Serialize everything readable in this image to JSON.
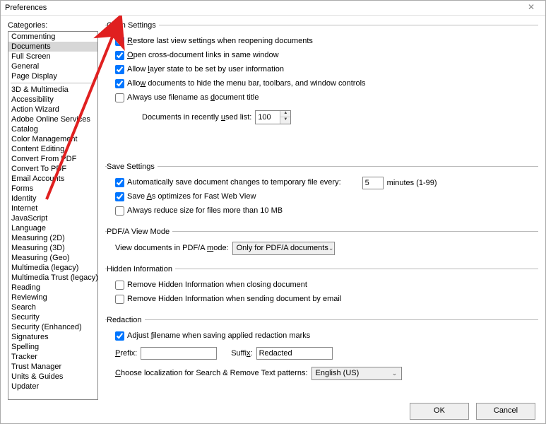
{
  "window": {
    "title": "Preferences"
  },
  "sidebar": {
    "header": "Categories:",
    "groups": [
      [
        "Commenting",
        "Documents",
        "Full Screen",
        "General",
        "Page Display"
      ],
      [
        "3D & Multimedia",
        "Accessibility",
        "Action Wizard",
        "Adobe Online Services",
        "Catalog",
        "Color Management",
        "Content Editing",
        "Convert From PDF",
        "Convert To PDF",
        "Email Accounts",
        "Forms",
        "Identity",
        "Internet",
        "JavaScript",
        "Language",
        "Measuring (2D)",
        "Measuring (3D)",
        "Measuring (Geo)",
        "Multimedia (legacy)",
        "Multimedia Trust (legacy)",
        "Reading",
        "Reviewing",
        "Search",
        "Security",
        "Security (Enhanced)",
        "Signatures",
        "Spelling",
        "Tracker",
        "Trust Manager",
        "Units & Guides",
        "Updater"
      ]
    ],
    "selected": "Documents"
  },
  "open_settings": {
    "legend": "Open Settings",
    "restore": "Restore last view settings when reopening documents",
    "cross": "Open cross-document links in same window",
    "layer": "Allow layer state to be set by user information",
    "hidemenu": "Allow documents to hide the menu bar, toolbars, and window controls",
    "filename": "Always use filename as document title",
    "recent_label": "Documents in recently used list:",
    "recent_value": "100"
  },
  "save_settings": {
    "legend": "Save Settings",
    "auto_label": "Automatically save document changes to temporary file every:",
    "auto_value": "5",
    "auto_unit": "minutes (1-99)",
    "fastweb": "Save As optimizes for Fast Web View",
    "reduce": "Always reduce size for files more than 10 MB"
  },
  "pdfa": {
    "legend": "PDF/A View Mode",
    "label": "View documents in PDF/A mode:",
    "value": "Only for PDF/A documents"
  },
  "hidden": {
    "legend": "Hidden Information",
    "closing": "Remove Hidden Information when closing document",
    "email": "Remove Hidden Information when sending document by email"
  },
  "redaction": {
    "legend": "Redaction",
    "adjust": "Adjust filename when saving applied redaction marks",
    "prefix_label": "Prefix:",
    "prefix_value": "",
    "suffix_label": "Suffix:",
    "suffix_value": "Redacted",
    "loc_label": "Choose localization for Search & Remove Text patterns:",
    "loc_value": "English (US)"
  },
  "buttons": {
    "ok": "OK",
    "cancel": "Cancel"
  }
}
